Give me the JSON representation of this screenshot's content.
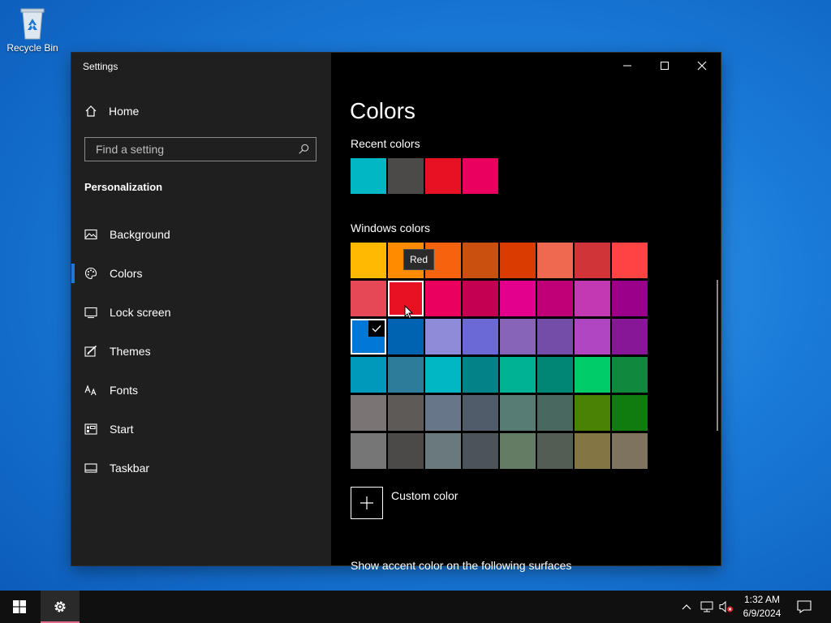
{
  "desktop": {
    "recycle_bin_label": "Recycle Bin"
  },
  "window": {
    "title": "Settings"
  },
  "sidebar": {
    "home_label": "Home",
    "search_placeholder": "Find a setting",
    "section_title": "Personalization",
    "items": [
      {
        "label": "Background",
        "icon": "image-icon"
      },
      {
        "label": "Colors",
        "icon": "palette-icon",
        "active": true
      },
      {
        "label": "Lock screen",
        "icon": "lock-screen-icon"
      },
      {
        "label": "Themes",
        "icon": "themes-icon"
      },
      {
        "label": "Fonts",
        "icon": "fonts-icon"
      },
      {
        "label": "Start",
        "icon": "start-icon"
      },
      {
        "label": "Taskbar",
        "icon": "taskbar-icon"
      }
    ]
  },
  "content": {
    "title": "Colors",
    "recent_label": "Recent colors",
    "recent_colors": [
      "#00b7c3",
      "#4c4a48",
      "#e81123",
      "#ea005e"
    ],
    "windows_label": "Windows colors",
    "windows_colors": [
      [
        "#ffb900",
        "#ff8c00",
        "#f7630c",
        "#ca5010",
        "#da3b01",
        "#ef6950",
        "#d13438",
        "#ff4343"
      ],
      [
        "#e74856",
        "#e81123",
        "#ea005e",
        "#c30052",
        "#e3008c",
        "#bf0077",
        "#c239b3",
        "#9a0089"
      ],
      [
        "#0078d7",
        "#0063b1",
        "#8e8cd8",
        "#6b69d6",
        "#8764b8",
        "#744da9",
        "#b146c2",
        "#881798"
      ],
      [
        "#0099bc",
        "#2d7d9a",
        "#00b7c3",
        "#038387",
        "#00b294",
        "#018574",
        "#00cc6a",
        "#10893e"
      ],
      [
        "#7a7574",
        "#5d5a58",
        "#68768a",
        "#515c6b",
        "#567c73",
        "#486860",
        "#498205",
        "#107c10"
      ],
      [
        "#767676",
        "#4c4a48",
        "#69797e",
        "#4a5459",
        "#647c64",
        "#525e54",
        "#847545",
        "#7e735f"
      ]
    ],
    "selected_color": "#0078d7",
    "hovered_color": "#e81123",
    "tooltip": "Red",
    "custom_color_label": "Custom color",
    "accent_surfaces_label": "Show accent color on the following surfaces"
  },
  "taskbar": {
    "time": "1:32 AM",
    "date": "6/9/2024"
  }
}
